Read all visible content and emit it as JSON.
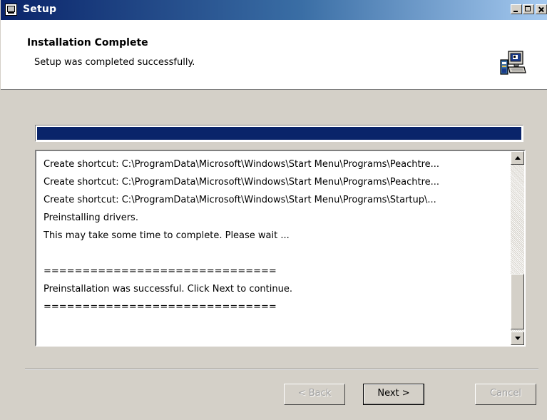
{
  "window": {
    "title": "Setup"
  },
  "header": {
    "title": "Installation Complete",
    "subtitle": "Setup was completed successfully."
  },
  "progress": {
    "value_percent": 100
  },
  "log": {
    "lines": [
      "Create shortcut: C:\\ProgramData\\Microsoft\\Windows\\Start Menu\\Programs\\Peachtre...",
      "Create shortcut: C:\\ProgramData\\Microsoft\\Windows\\Start Menu\\Programs\\Peachtre...",
      "Create shortcut: C:\\ProgramData\\Microsoft\\Windows\\Start Menu\\Programs\\Startup\\...",
      "Preinstalling drivers.",
      "This may take some time to complete. Please wait ...",
      "",
      "==============================",
      "Preinstallation was successful. Click Next to continue.",
      "=============================="
    ]
  },
  "buttons": {
    "back": "< Back",
    "next": "Next >",
    "cancel": "Cancel"
  },
  "colors": {
    "title_bar": "#0a246a",
    "progress_fill": "#0a246a",
    "face": "#d4d0c8"
  },
  "icons": {
    "title": "setup-app-icon",
    "header": "computer-install-icon"
  }
}
